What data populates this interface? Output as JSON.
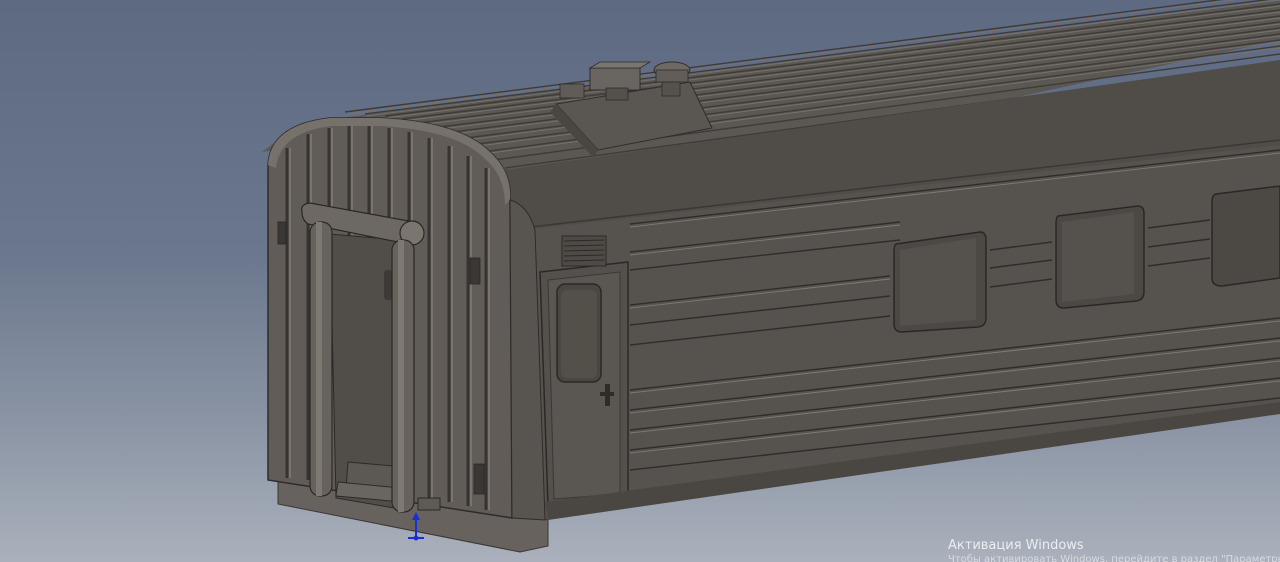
{
  "viewport": {
    "background_top": "#5d6a82",
    "background_bottom": "#aab1bc",
    "model_color": "#56524e"
  },
  "model": {
    "name": "passenger-railcar-body"
  },
  "triad": {
    "icon": "coordinate-triad-icon",
    "color": "#1a2ed8"
  },
  "watermark": {
    "title": "Активация Windows",
    "subtitle": "Чтобы активировать Windows, перейдите в раздел \"Параметры\"."
  }
}
